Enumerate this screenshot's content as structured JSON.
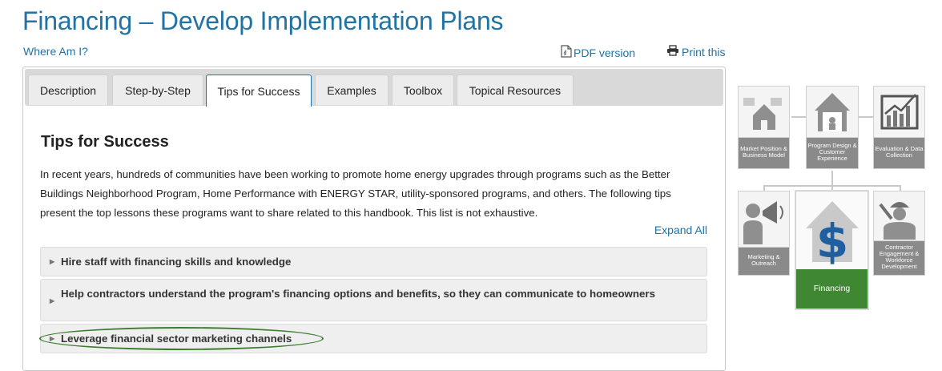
{
  "header": {
    "title": "Financing – Develop Implementation Plans",
    "where_link": "Where Am I?",
    "pdf_link": "PDF version",
    "print_link": "Print this"
  },
  "tabs": [
    {
      "label": "Description",
      "active": false
    },
    {
      "label": "Step-by-Step",
      "active": false
    },
    {
      "label": "Tips for Success",
      "active": true
    },
    {
      "label": "Examples",
      "active": false
    },
    {
      "label": "Toolbox",
      "active": false
    },
    {
      "label": "Topical Resources",
      "active": false
    }
  ],
  "content": {
    "title": "Tips for Success",
    "intro": "In recent years, hundreds of communities have been working to promote home energy upgrades through programs such as the Better Buildings Neighborhood Program, Home Performance with ENERGY STAR, utility-sponsored programs, and others. The following tips present the top lessons these programs want to share related to this handbook. This list is not exhaustive.",
    "expand_all": "Expand All",
    "accordion": [
      {
        "label": "Hire staff with financing skills and knowledge"
      },
      {
        "label": "Help contractors understand the program's financing options and benefits, so they can communicate to homeowners"
      },
      {
        "label": "Leverage financial sector marketing channels",
        "highlighted": true
      }
    ]
  },
  "diagram": {
    "market": "Market Position & Business Model",
    "program": "Program Design & Customer Experience",
    "evaluation": "Evaluation & Data Collection",
    "marketing": "Marketing & Outreach",
    "financing": "Financing",
    "contractor": "Contractor Engagement & Workforce Development"
  },
  "colors": {
    "link": "#2273a5",
    "financing_green": "#3f8733",
    "highlight_oval": "#3c7d2e"
  }
}
